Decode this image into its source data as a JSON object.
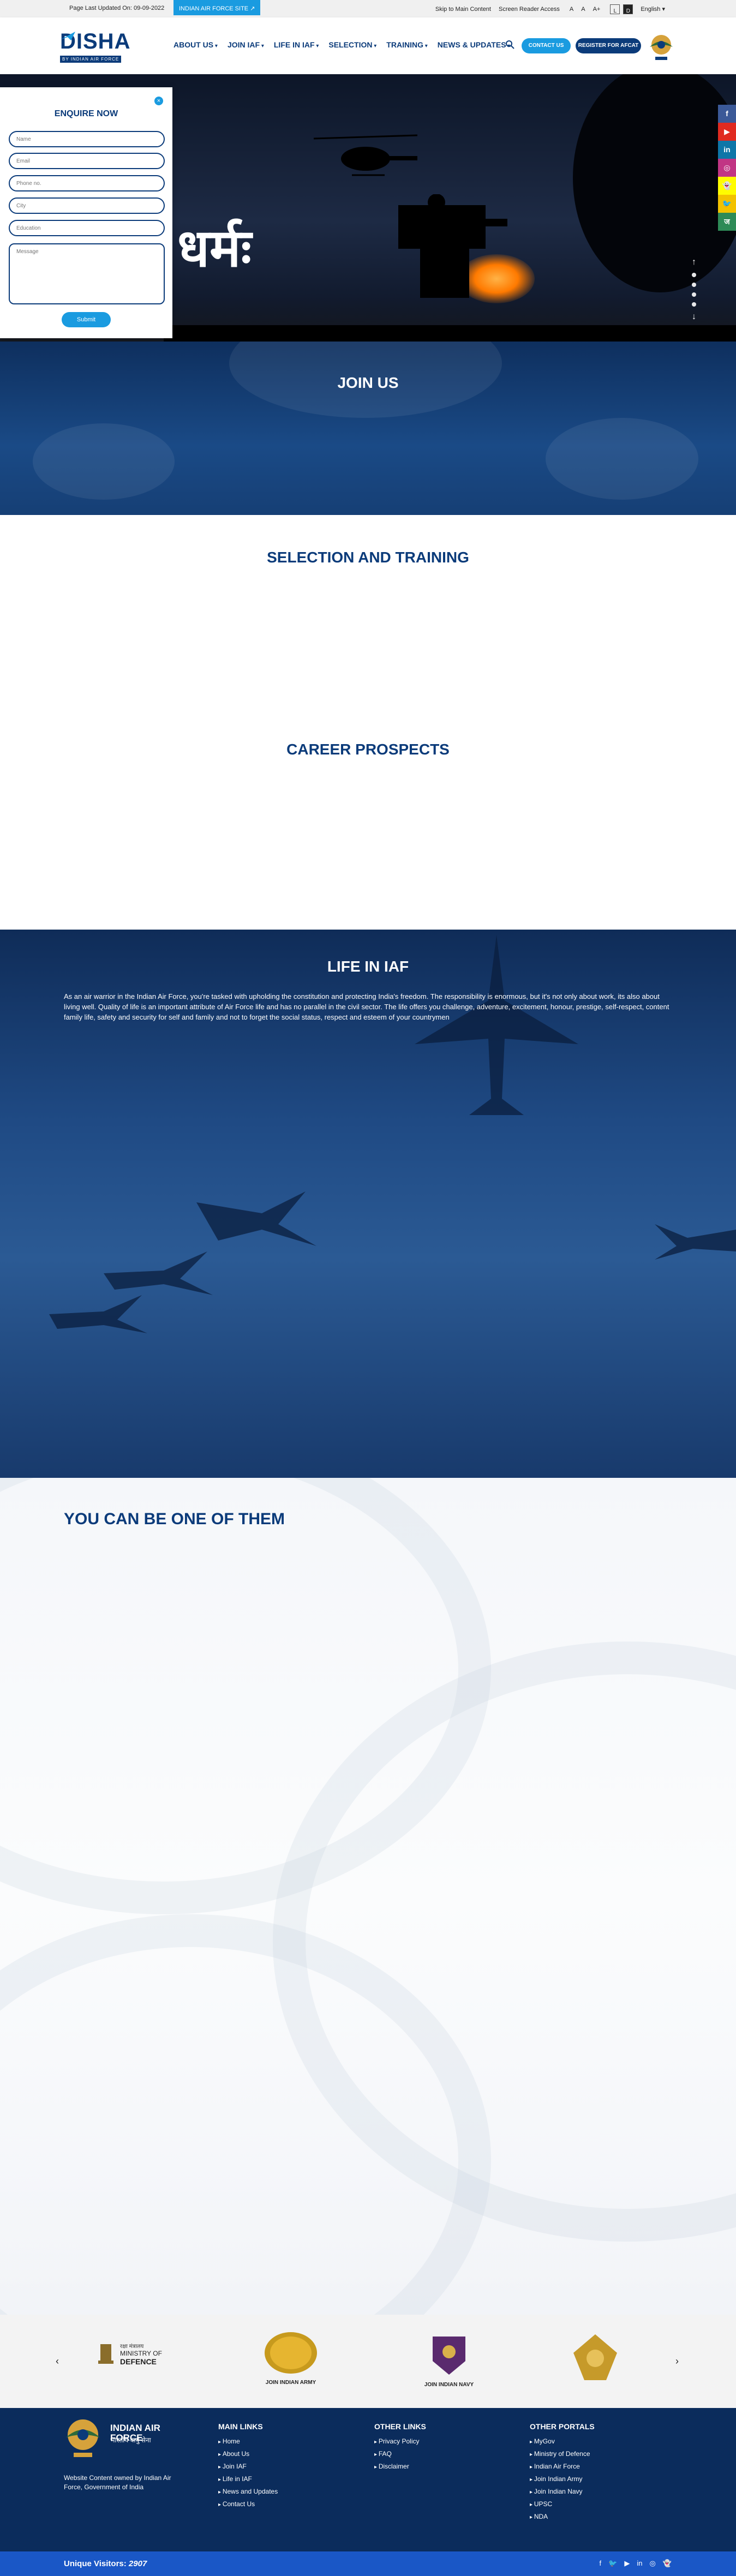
{
  "topbar": {
    "last_updated": "Page Last Updated On: 09-09-2022",
    "site_link": "INDIAN AIR FORCE SITE ↗",
    "skip": "Skip to Main Content",
    "screen_reader": "Screen Reader Access",
    "font_sizes": [
      "A",
      "A",
      "A+"
    ],
    "contrast": [
      "L",
      "D"
    ],
    "language": "English ▾"
  },
  "header": {
    "logo_word": "DISHA",
    "logo_sub": "BY INDIAN AIR FORCE",
    "nav": [
      "ABOUT US",
      "JOIN IAF",
      "LIFE IN IAF",
      "SELECTION",
      "TRAINING",
      "NEWS & UPDATES"
    ],
    "contact_btn": "CONTACT US",
    "register_btn": "REGISTER FOR AFCAT"
  },
  "hero": {
    "slogan": "धर्मः"
  },
  "enquire": {
    "title": "ENQUIRE NOW",
    "close": "×",
    "placeholders": {
      "name": "Name",
      "email": "Email",
      "phone": "Phone no.",
      "city": "City",
      "education": "Education",
      "message": "Message"
    },
    "submit": "Submit"
  },
  "social_sidebar": [
    "f",
    "▶",
    "in",
    "◎",
    "👻",
    "🐦",
    "ज"
  ],
  "sections": {
    "join_us": "JOIN US",
    "selection_training": "SELECTION AND TRAINING",
    "career_prospects": "CAREER PROSPECTS",
    "life_in_iaf": "LIFE IN IAF",
    "life_text": "As an air warrior in the Indian Air Force, you're tasked with upholding the constitution and protecting India's freedom. The responsibility is enormous, but it's not only about work, its also about living well. Quality of life is an important attribute of Air Force life and has no parallel in the civil sector. The life offers you challenge, adventure, excitement, honour, prestige, self-respect, content family life, safety and security for self and family and not to forget the social status, respect and esteem of your countrymen",
    "one_of_them": "YOU CAN BE ONE OF THEM"
  },
  "partners": {
    "prev": "‹",
    "next": "›",
    "items": [
      {
        "line1": "रक्षा मंत्रालय",
        "line2": "MINISTRY OF",
        "line3": "DEFENCE"
      },
      {
        "label": "JOIN INDIAN ARMY"
      },
      {
        "label": "JOIN INDIAN NAVY"
      },
      {
        "label": ""
      }
    ]
  },
  "footer": {
    "brand_name": "INDIAN AIR FORCE",
    "brand_hindi": "भारतीय वायु सेना",
    "owned_by": "Website Content owned by Indian Air Force, Government of India",
    "main_links_title": "MAIN LINKS",
    "main_links": [
      "Home",
      "About Us",
      "Join IAF",
      "Life in IAF",
      "News and Updates",
      "Contact Us"
    ],
    "other_links_title": "OTHER LINKS",
    "other_links": [
      "Privacy Policy",
      "FAQ",
      "Disclaimer"
    ],
    "other_portals_title": "OTHER PORTALS",
    "other_portals": [
      "MyGov",
      "Ministry of Defence",
      "Indian Air Force",
      "Join Indian Army",
      "Join Indian Navy",
      "UPSC",
      "NDA"
    ]
  },
  "bottom": {
    "visitors_label": "Unique Visitors:",
    "visitors_count": "2907",
    "social": [
      "f",
      "🐦",
      "▶",
      "in",
      "◎",
      "👻"
    ]
  },
  "colors": {
    "navy": "#0b3b7a",
    "accent": "#1a9be0",
    "footer": "#0b2c5c",
    "bottom_bar": "#1a57c6"
  }
}
